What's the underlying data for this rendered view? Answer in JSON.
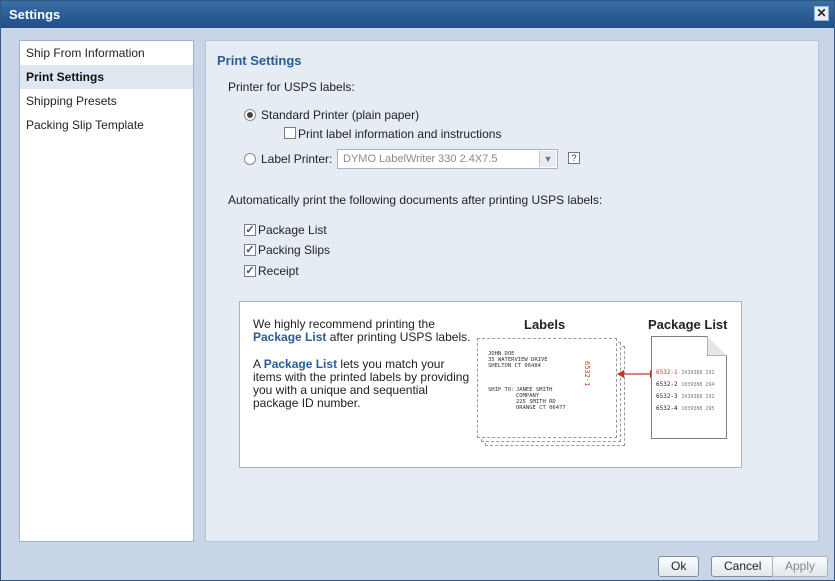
{
  "window": {
    "title": "Settings",
    "close_glyph": "✕"
  },
  "sidebar": {
    "items": [
      {
        "label": "Ship From Information"
      },
      {
        "label": "Print Settings",
        "active": true
      },
      {
        "label": "Shipping Presets"
      },
      {
        "label": "Packing Slip Template"
      }
    ]
  },
  "print_settings": {
    "title": "Print Settings",
    "printer_heading": "Printer for USPS labels:",
    "standard_printer": "Standard Printer (plain paper)",
    "print_label_info": "Print label information and instructions",
    "label_printer": "Label Printer:",
    "label_printer_select": "DYMO LabelWriter 330 2.4X7.5",
    "help_glyph": "?",
    "auto_print_heading": "Automatically print the following documents after printing USPS labels:",
    "auto_print_items": [
      {
        "label": "Package List",
        "checked": true
      },
      {
        "label": "Packing Slips",
        "checked": true
      },
      {
        "label": "Receipt",
        "checked": true
      }
    ],
    "check_glyph": "✓"
  },
  "recommendation": {
    "line1": "We highly recommend printing the",
    "link1": "Package List",
    "line2_rest": " after printing USPS labels.",
    "para2_prefix": "A ",
    "link2": "Package List",
    "para2_rest1": " lets you match your",
    "para2_line2": "items with the printed labels by providing",
    "para2_line3": "you with a unique and sequential",
    "para2_line4": "package ID number.",
    "labels_heading": "Labels",
    "package_list_heading": "Package List",
    "label_sender": "JOHN DOE\n35 WATERVIEW DRIVE\nSHELTON CT 06484",
    "label_ship_to": "SHIP TO:",
    "label_recipient": "JANEE SMITH\nCOMPANY\n225 SMITH RD\nORANGE CT 06477",
    "label_id": "6532-1",
    "list_rows": [
      {
        "id": "6532-1",
        "extra": "1039388  192"
      },
      {
        "id": "6532-2",
        "extra": "1039388  294"
      },
      {
        "id": "6532-3",
        "extra": "1039388  192"
      },
      {
        "id": "6532-4",
        "extra": "1039388  295"
      }
    ],
    "accent_color": "#c0392b"
  },
  "buttons": {
    "ok": "Ok",
    "cancel": "Cancel",
    "apply": "Apply"
  }
}
